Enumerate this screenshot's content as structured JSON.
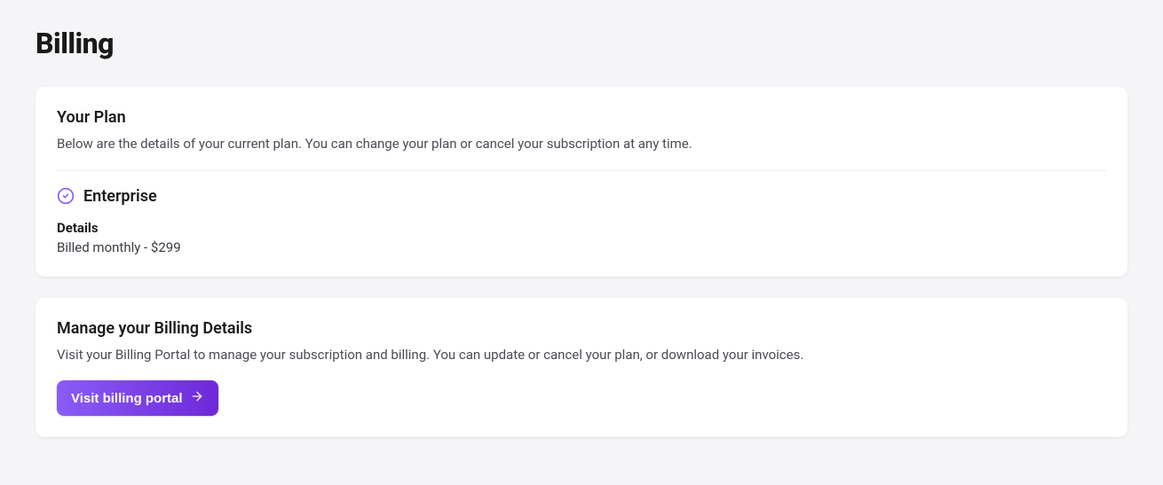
{
  "page": {
    "title": "Billing"
  },
  "plan_card": {
    "title": "Your Plan",
    "description": "Below are the details of your current plan. You can change your plan or cancel your subscription at any time.",
    "plan_name": "Enterprise",
    "details_label": "Details",
    "details_value": "Billed monthly - $299",
    "icon_color": "#8b5cf6"
  },
  "manage_card": {
    "title": "Manage your Billing Details",
    "description": "Visit your Billing Portal to manage your subscription and billing. You can update or cancel your plan, or download your invoices.",
    "button_label": "Visit billing portal"
  }
}
